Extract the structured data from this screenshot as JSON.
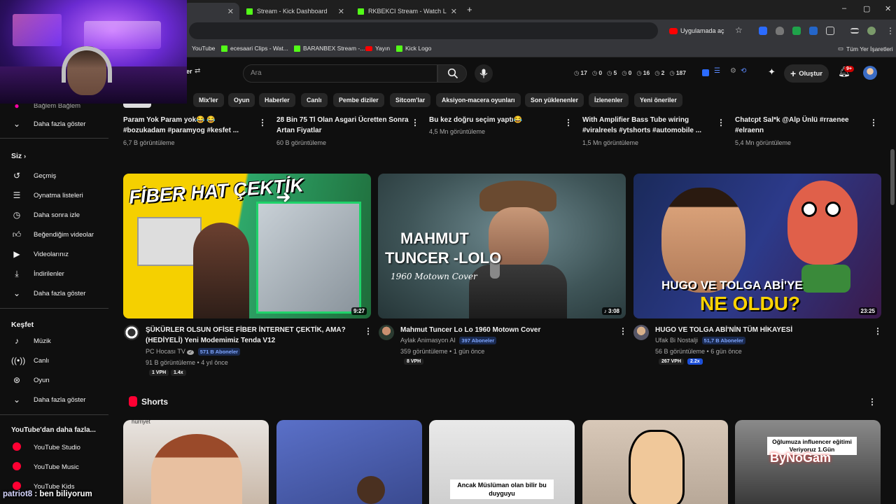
{
  "browser": {
    "tabs": [
      {
        "label": "",
        "active": true
      },
      {
        "label": "Stream - Kick Dashboard",
        "active": false
      },
      {
        "label": "RKBEKCI Stream - Watch Live o",
        "active": false
      }
    ],
    "new_tab": "+",
    "window_controls": {
      "minimize": "–",
      "maximize": "▢",
      "close": "✕"
    },
    "app_button": "Uygulamada aç",
    "bookmarks": [
      "YouTube",
      "ecesaari Clips - Wat...",
      "BARANBEX Stream -...",
      "Yayın",
      "Kick Logo"
    ],
    "all_bookmarks": "Tüm Yer İşaretleri"
  },
  "header": {
    "search_placeholder": "Ara",
    "stats": [
      "17",
      "0",
      "5",
      "0",
      "16",
      "2",
      "187"
    ],
    "create_label": "Oluştur",
    "notif_count": "9+",
    "menu_partial": "er"
  },
  "chips": [
    "Mix'ler",
    "Oyun",
    "Haberler",
    "Canlı",
    "Pembe diziler",
    "Sitcom'lar",
    "Aksiyon-macera oyunları",
    "Son yüklenenler",
    "İzlenenler",
    "Yeni öneriler"
  ],
  "sidebar": {
    "top_partial": "Bağlem Bağlem",
    "show_more_1": "Daha fazla göster",
    "you_heading": "Siz",
    "you_items": [
      "Geçmiş",
      "Oynatma listeleri",
      "Daha sonra izle",
      "Beğendiğim videolar",
      "Videolarınız",
      "İndirilenler"
    ],
    "show_more_2": "Daha fazla göster",
    "explore_heading": "Keşfet",
    "explore_items": [
      "Müzik",
      "Canlı",
      "Oyun"
    ],
    "show_more_3": "Daha fazla göster",
    "more_heading": "YouTube'dan daha fazla...",
    "more_items": [
      "YouTube Studio",
      "YouTube Music",
      "YouTube Kids"
    ]
  },
  "top_row": [
    {
      "title": "Param Yok Param yok😂 😂 #bozukadam #paramyog #kesfet ...",
      "views": "6,7 B görüntüleme"
    },
    {
      "title": "28 Bin 75 Tl Olan Asgari Ücretten Sonra Artan Fiyatlar",
      "views": "60 B görüntüleme"
    },
    {
      "title": "Bu kez doğru seçim yaptı😂",
      "views": "4,5 Mn görüntüleme"
    },
    {
      "title": "With Amplifier Bass Tube wiring #viralreels #ytshorts #automobile ...",
      "views": "1,5 Mn görüntüleme"
    },
    {
      "title": "Chatcpt Sal*k @Alp Ünlü #rraenee #elraenn",
      "views": "5,4 Mn görüntüleme"
    }
  ],
  "videos": [
    {
      "thumb_text": "FİBER HAT ÇEKTİK",
      "duration": "9:27",
      "title": "ŞÜKÜRLER OLSUN OFİSE FİBER İNTERNET ÇEKTİK, AMA? (HEDİYELİ) Yeni Modemimiz Tenda V12",
      "channel": "PC Hocası TV",
      "verified": "✓",
      "subs": "571 B Aboneler",
      "meta": "91 B görüntüleme • 4 yıl önce",
      "badges": [
        "1 VPH",
        "1.4x"
      ]
    },
    {
      "thumb_text_1": "MAHMUT",
      "thumb_text_2": "TUNCER -LOLO",
      "thumb_text_3": "1960 Motown Cover",
      "duration": "♪ 3:08",
      "title": "Mahmut Tuncer Lo Lo 1960 Motown Cover",
      "channel": "Aylak Animasyon AI",
      "subs": "397 Aboneler",
      "meta": "359 görüntüleme • 1 gün önce",
      "badges": [
        "8 VPH"
      ]
    },
    {
      "thumb_text_1": "HUGO VE TOLGA ABİ'YE",
      "thumb_text_2": "NE OLDU?",
      "duration": "23:25",
      "title": "HUGO VE TOLGA ABİ'NİN TÜM HİKAYESİ",
      "channel": "Ufak Bi Nostalji",
      "subs": "51,7 B Aboneler",
      "meta": "56 B görüntüleme • 6 gün önce",
      "badges": [
        "267 VPH",
        "2.2x"
      ]
    }
  ],
  "shorts": {
    "heading": "Shorts",
    "items": [
      {
        "caption": "hurriyet"
      },
      {
        "caption": ""
      },
      {
        "caption": "Ancak Müslüman olan bilir bu duyguyu"
      },
      {
        "caption": ""
      },
      {
        "caption": "Oğlumuza influencer eğitimi Veriyoruz 1.Gün"
      }
    ],
    "watermark": "ByNoGam"
  },
  "chat": {
    "user": "patriot8",
    "message": " : ben biliyorum"
  },
  "colors": {
    "bg": "#0f0f0f",
    "chip": "#272727",
    "accent_red": "#ff0033",
    "kick_green": "#53fc18"
  }
}
